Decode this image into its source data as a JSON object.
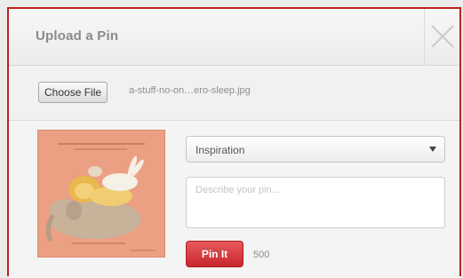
{
  "dialog": {
    "title": "Upload a Pin",
    "close_icon": "close-icon"
  },
  "file": {
    "button_label": "Choose File",
    "file_name": "a-stuff-no-on…ero-sleep.jpg"
  },
  "preview": {
    "image_kind": "illustration of sleeping animals",
    "background_color": "#eb9f83"
  },
  "board_select": {
    "selected": "Inspiration"
  },
  "description": {
    "placeholder": "Describe your pin...",
    "value": ""
  },
  "actions": {
    "pin_label": "Pin It",
    "char_count": "500"
  },
  "colors": {
    "accent": "#c0231d",
    "pin_button": "#d0343a"
  }
}
